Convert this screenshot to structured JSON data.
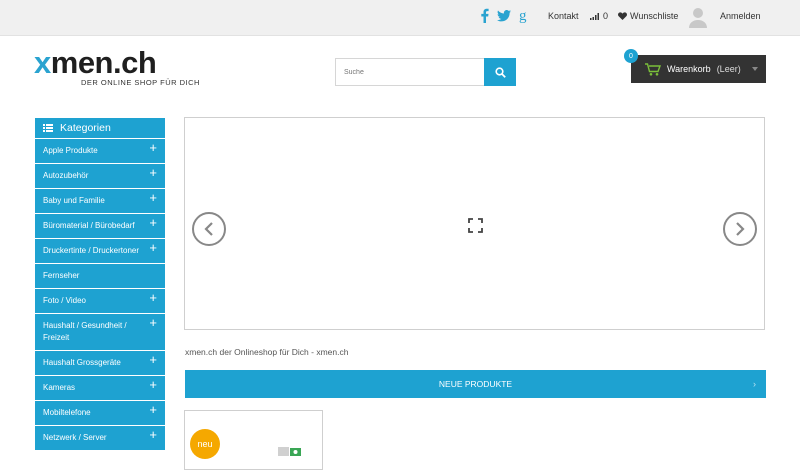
{
  "topbar": {
    "social_icons": [
      "facebook-icon",
      "twitter-icon",
      "google-plus-icon"
    ],
    "contact_label": "Kontakt",
    "compare_count": "0",
    "wishlist_label": "Wunschliste",
    "login_label": "Anmelden"
  },
  "logo": {
    "x_letter": "x",
    "rest": "men.ch",
    "tagline": "DER ONLINE SHOP FÜR DICH"
  },
  "search": {
    "placeholder": "Suche"
  },
  "cart": {
    "count": "0",
    "label": "Warenkorb",
    "status": "(Leer)"
  },
  "sidebar": {
    "title": "Kategorien",
    "items": [
      {
        "label": "Apple Produkte"
      },
      {
        "label": "Autozubehör"
      },
      {
        "label": "Baby und Familie"
      },
      {
        "label": "Büromaterial / Bürobedarf"
      },
      {
        "label": "Druckertinte / Druckertoner"
      },
      {
        "label": "Fernseher"
      },
      {
        "label": "Foto / Video"
      },
      {
        "label": "Haushalt / Gesundheit / Freizeit"
      },
      {
        "label": "Haushalt Grossgeräte"
      },
      {
        "label": "Kameras"
      },
      {
        "label": "Mobiltelefone"
      },
      {
        "label": "Netzwerk / Server"
      }
    ]
  },
  "main": {
    "tagline": "xmen.ch der Onlineshop für Dich - xmen.ch",
    "new_products_label": "NEUE PRODUKTE",
    "product_badge": "neu"
  },
  "colors": {
    "accent": "#1ea2d1",
    "badge": "#f5a800",
    "cart_bg": "#333333"
  }
}
